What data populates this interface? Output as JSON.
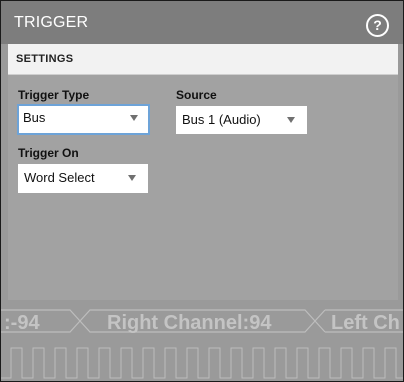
{
  "titlebar": {
    "title": "TRIGGER",
    "help_glyph": "?",
    "help_icon": "help-circle-icon"
  },
  "settings": {
    "header": "SETTINGS",
    "trigger_type": {
      "label": "Trigger Type",
      "value": "Bus"
    },
    "source": {
      "label": "Source",
      "value": "Bus 1 (Audio)"
    },
    "trigger_on": {
      "label": "Trigger On",
      "value": "Word Select"
    }
  },
  "bus_decode": {
    "segments": [
      ":-94",
      "Right Channel:94",
      "Left Ch"
    ]
  },
  "colors": {
    "titlebar_bg": "#7d7d7d",
    "panel_bg": "#9a9a9a",
    "focus_border": "#6da3d8"
  }
}
